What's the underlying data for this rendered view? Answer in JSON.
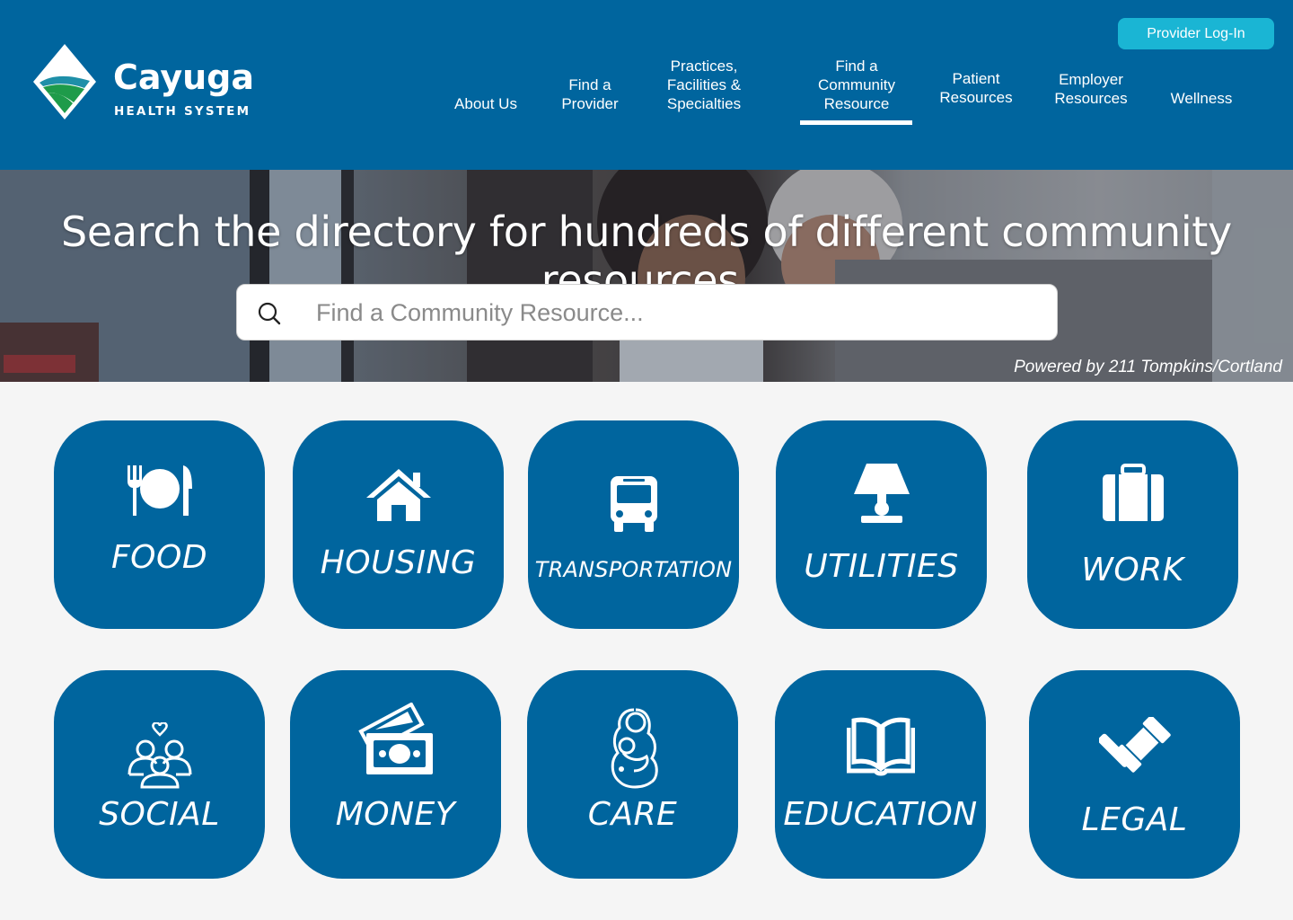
{
  "brand": {
    "name": "Cayuga",
    "subtitle": "HEALTH SYSTEM",
    "colors": {
      "primary": "#00659e",
      "accent": "#1ab5d4",
      "logo_green": "#1e9b4a",
      "background": "#f5f5f5"
    }
  },
  "header": {
    "provider_login": "Provider Log-In",
    "nav": [
      {
        "lines": [
          "About Us"
        ]
      },
      {
        "lines": [
          "Find a",
          "Provider"
        ]
      },
      {
        "lines": [
          "Practices,",
          "Facilities &",
          "Specialties"
        ]
      },
      {
        "lines": [
          "Find a",
          "Community",
          "Resource"
        ],
        "active": true
      },
      {
        "lines": [
          "Patient",
          "Resources"
        ]
      },
      {
        "lines": [
          "Employer",
          "Resources"
        ]
      },
      {
        "lines": [
          "Wellness"
        ]
      }
    ]
  },
  "hero": {
    "title": "Search the directory for hundreds of different community resources.",
    "search_placeholder": "Find a Community Resource...",
    "search_value": "",
    "powered_by": "Powered by 211 Tompkins/Cortland"
  },
  "categories": [
    {
      "label": "FOOD",
      "icon": "plate-cutlery-icon"
    },
    {
      "label": "HOUSING",
      "icon": "house-icon"
    },
    {
      "label": "TRANSPORTATION",
      "icon": "bus-icon"
    },
    {
      "label": "UTILITIES",
      "icon": "lamp-icon"
    },
    {
      "label": "WORK",
      "icon": "briefcase-icon"
    },
    {
      "label": "SOCIAL",
      "icon": "people-heart-icon"
    },
    {
      "label": "MONEY",
      "icon": "money-icon"
    },
    {
      "label": "CARE",
      "icon": "mother-child-icon"
    },
    {
      "label": "EDUCATION",
      "icon": "open-book-icon"
    },
    {
      "label": "LEGAL",
      "icon": "gavel-icon"
    }
  ]
}
